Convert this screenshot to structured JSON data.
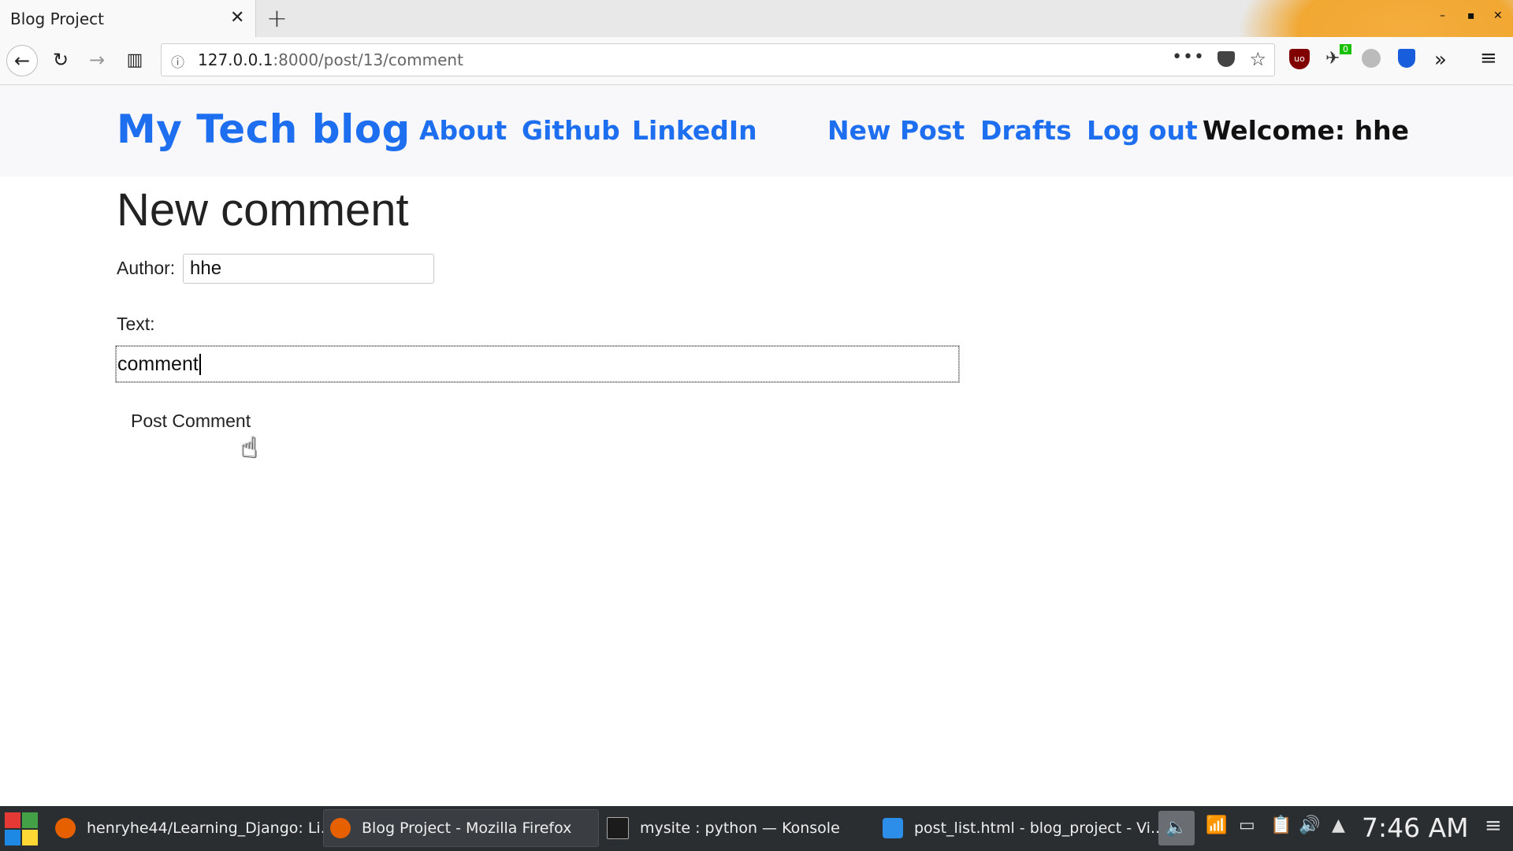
{
  "browser": {
    "tab_title": "Blog Project",
    "url_host": "127.0.0.1",
    "url_rest": ":8000/post/13/comment",
    "extension_badge": "0"
  },
  "site": {
    "brand": "My Tech blog",
    "nav_left": [
      "About",
      "Github",
      "LinkedIn"
    ],
    "nav_right": [
      "New Post",
      "Drafts",
      "Log out"
    ],
    "welcome": "Welcome: hhe",
    "accent_color": "#1e6ff0"
  },
  "form": {
    "title": "New comment",
    "author_label": "Author:",
    "author_value": "hhe",
    "text_label": "Text:",
    "text_value": "comment",
    "submit_label": "Post Comment"
  },
  "taskbar": {
    "tasks": [
      "henryhe44/Learning_Django: Li...",
      "Blog Project - Mozilla Firefox",
      "mysite : python — Konsole",
      "post_list.html - blog_project - Vi..."
    ],
    "clock": "7:46 AM"
  }
}
